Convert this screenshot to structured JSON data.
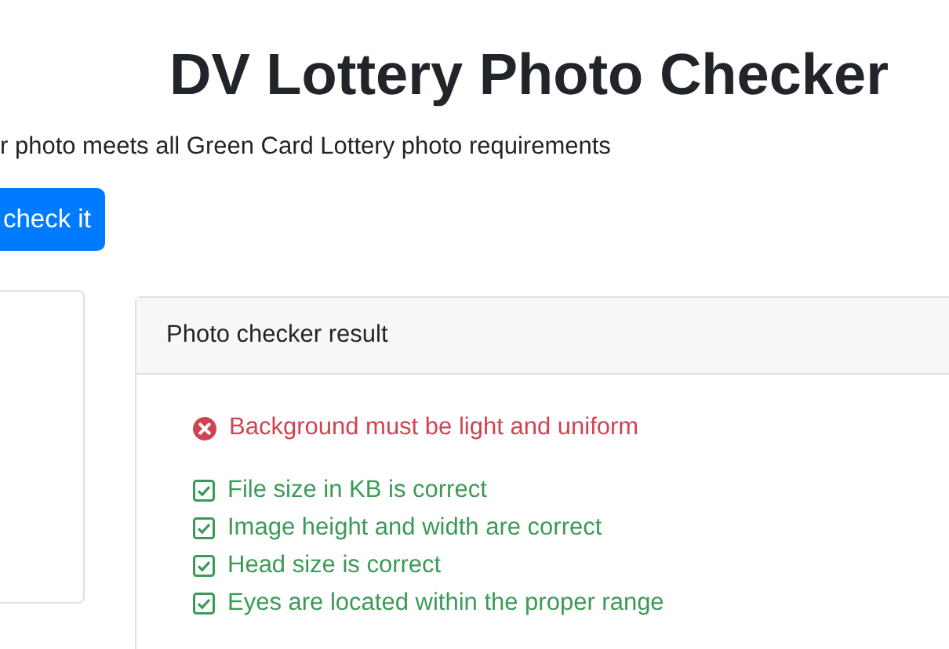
{
  "title": "DV Lottery Photo Checker",
  "subtitle": "r photo meets all Green Card Lottery photo requirements",
  "button": "check it",
  "result": {
    "header": "Photo checker result",
    "items": [
      {
        "kind": "error",
        "text": "Background must be light and uniform"
      },
      {
        "kind": "ok",
        "text": "File size in KB is correct"
      },
      {
        "kind": "ok",
        "text": "Image height and width are correct"
      },
      {
        "kind": "ok",
        "text": "Head size is correct"
      },
      {
        "kind": "ok",
        "text": "Eyes are located within the proper range"
      }
    ]
  }
}
